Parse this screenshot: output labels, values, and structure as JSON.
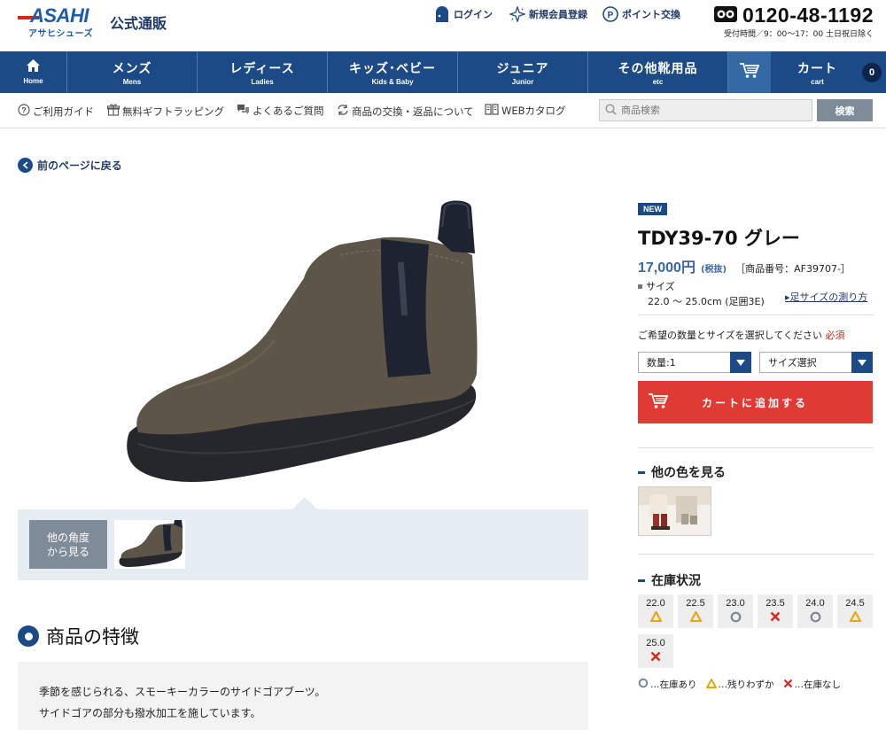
{
  "header": {
    "logo_main": "ASAHI",
    "logo_sub": "アサヒシューズ",
    "site_title": "公式通販",
    "links": [
      {
        "label": "ログイン",
        "icon": "login-door-icon"
      },
      {
        "label": "新規会員登録",
        "icon": "sparkle-register-icon"
      },
      {
        "label": "ポイント交換",
        "icon": "point-p-icon"
      }
    ],
    "phone": "0120-48-1192",
    "phone_note": "受付時間／9：00～17：00 土日祝日除く"
  },
  "nav": {
    "home": {
      "en": "Home",
      "icon": "home-icon"
    },
    "categories": [
      {
        "jp": "メンズ",
        "en": "Mens"
      },
      {
        "jp": "レディース",
        "en": "Ladies"
      },
      {
        "jp": "キッズ･ベビー",
        "en": "Kids & Baby"
      },
      {
        "jp": "ジュニア",
        "en": "Junior"
      },
      {
        "jp": "その他靴用品",
        "en": "etc"
      }
    ],
    "cart": {
      "jp": "カート",
      "en": "cart",
      "count": "0"
    }
  },
  "subnav": {
    "items": [
      {
        "label": "ご利用ガイド",
        "icon": "help-icon"
      },
      {
        "label": "無料ギフトラッピング",
        "icon": "gift-icon"
      },
      {
        "label": "よくあるご質問",
        "icon": "faq-chat-icon"
      },
      {
        "label": "商品の交換・返品について",
        "icon": "exchange-icon"
      },
      {
        "label": "WEBカタログ",
        "icon": "catalog-book-icon"
      }
    ],
    "search_placeholder": "商品検索",
    "search_button": "検索"
  },
  "back_link": "前のページに戻る",
  "gallery": {
    "angle_button": "他の角度\nから見る"
  },
  "features": {
    "heading": "商品の特徴",
    "lines": [
      "季節を感じられる、スモーキーカラーのサイドゴアブーツ。",
      "サイドゴアの部分も撥水加工を施しています。"
    ]
  },
  "product": {
    "badge": "NEW",
    "name": "TDY39-70 グレー",
    "price": "17,000円",
    "tax": "(税抜)",
    "code": "［商品番号：AF39707-］",
    "size_label": "サイズ",
    "size_range": "22.0 ～ 25.0cm (足囲3E)",
    "size_link": "足サイズの測り方",
    "select_prompt": "ご希望の数量とサイズを選択してください",
    "required": "必須",
    "qty_select": "数量:1",
    "size_select": "サイズ選択",
    "cart_button": "カートに追加する",
    "colors_heading": "他の色を見る",
    "stock_heading": "在庫状況",
    "stock": [
      {
        "size": "22.0",
        "status": "few"
      },
      {
        "size": "22.5",
        "status": "few"
      },
      {
        "size": "23.0",
        "status": "in"
      },
      {
        "size": "23.5",
        "status": "none"
      },
      {
        "size": "24.0",
        "status": "in"
      },
      {
        "size": "24.5",
        "status": "few"
      },
      {
        "size": "25.0",
        "status": "none"
      }
    ],
    "legend": [
      {
        "status": "in",
        "label": "…在庫あり"
      },
      {
        "status": "few",
        "label": "…残りわずか"
      },
      {
        "status": "none",
        "label": "…在庫なし"
      }
    ]
  },
  "colors": {
    "brand_blue": "#1b4a86",
    "cart_red": "#e03a35",
    "price_blue": "#3a67a7",
    "stock_in": "#7a8796",
    "stock_few": "#e6a90f",
    "stock_none": "#d9261c"
  }
}
